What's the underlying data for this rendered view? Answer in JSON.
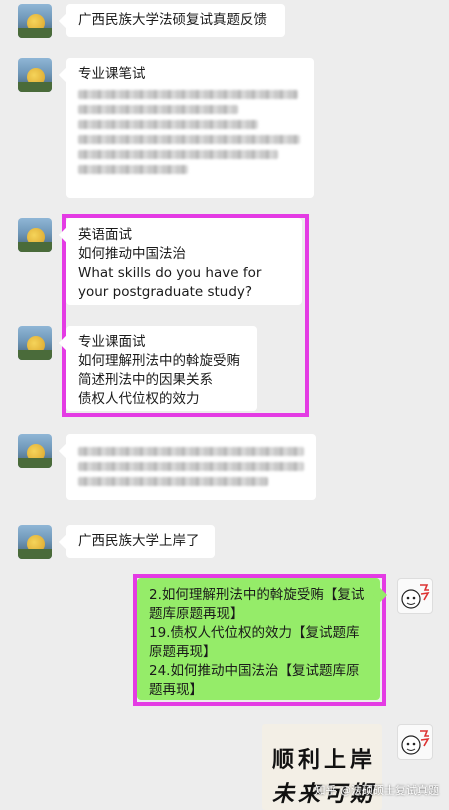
{
  "messages": {
    "m1": "广西民族大学法硕复试真题反馈",
    "m2_title": "专业课笔试",
    "english": [
      "英语面试",
      "如何推动中国法治",
      "What skills do you have for your postgraduate study?"
    ],
    "professional": [
      "专业课面试",
      "如何理解刑法中的斡旋受贿",
      "简述刑法中的因果关系",
      "债权人代位权的效力"
    ],
    "m5": "广西民族大学上岸了",
    "reply": [
      "2.如何理解刑法中的斡旋受贿【复试题库原题再现】",
      "19.债权人代位权的效力【复试题库原题再现】",
      "24.如何推动中国法治【复试题库原题再现】"
    ]
  },
  "sticker": {
    "line1": "顺利上岸",
    "line2": "未来可期"
  },
  "watermark": "知乎 @法硕硕士复试真题",
  "colors": {
    "background": "#ededed",
    "sent_bubble": "#95ec69",
    "highlight": "#e43be4"
  }
}
